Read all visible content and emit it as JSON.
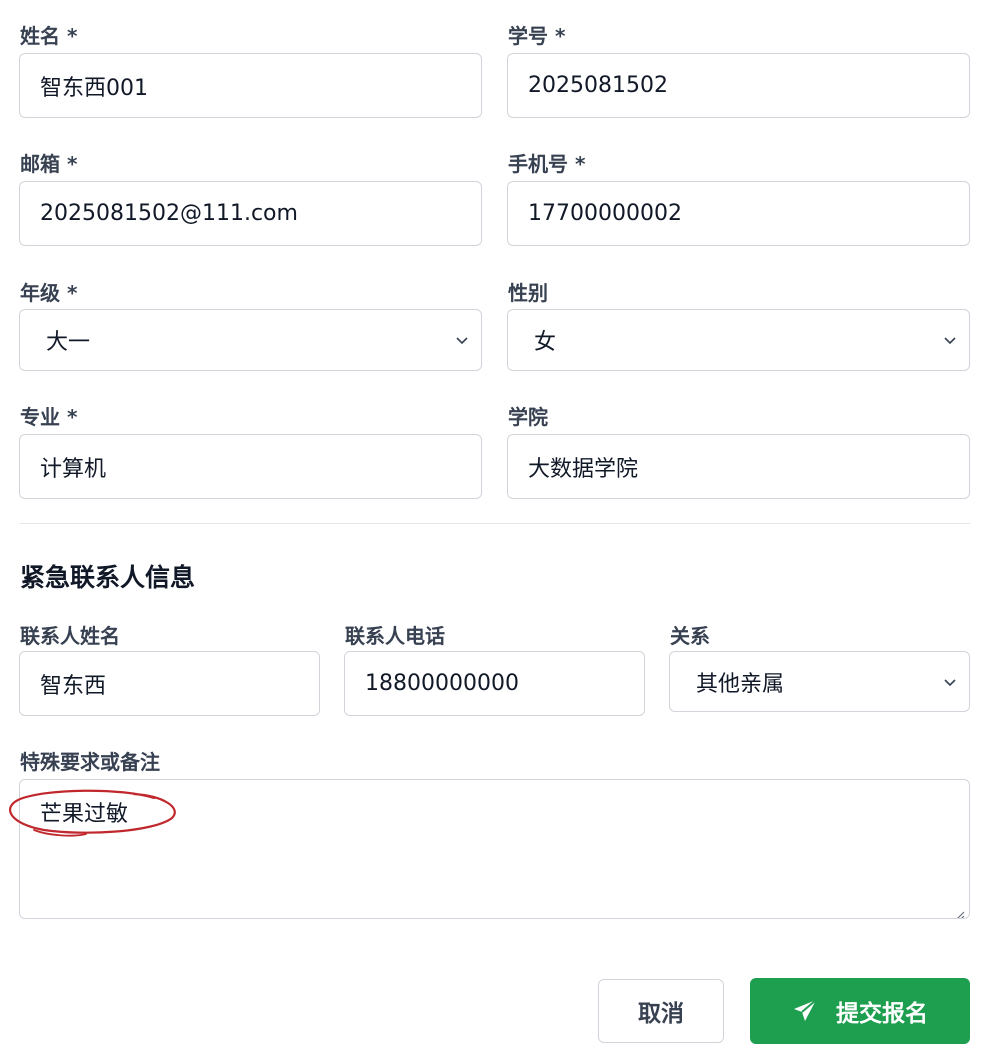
{
  "form": {
    "name": {
      "label": "姓名 *",
      "value": "智东西001"
    },
    "student_id": {
      "label": "学号 *",
      "value": "2025081502"
    },
    "email": {
      "label": "邮箱 *",
      "value": "2025081502@111.com"
    },
    "phone": {
      "label": "手机号 *",
      "value": "17700000002"
    },
    "grade": {
      "label": "年级 *",
      "value": "大一"
    },
    "gender": {
      "label": "性别",
      "value": "女"
    },
    "major": {
      "label": "专业 *",
      "value": "计算机"
    },
    "college": {
      "label": "学院",
      "value": "大数据学院"
    }
  },
  "emergency": {
    "title": "紧急联系人信息",
    "contact_name": {
      "label": "联系人姓名",
      "value": "智东西"
    },
    "contact_phone": {
      "label": "联系人电话",
      "value": "18800000000"
    },
    "relation": {
      "label": "关系",
      "value": "其他亲属"
    }
  },
  "notes": {
    "label": "特殊要求或备注",
    "value": "芒果过敏"
  },
  "buttons": {
    "cancel": "取消",
    "submit": "提交报名"
  },
  "colors": {
    "primary": "#1e9e4f",
    "annotation": "#c0282d",
    "border": "#d1d5db"
  },
  "icons": {
    "submit": "paper-plane-icon",
    "select": "chevron-down-icon",
    "resize": "resize-handle-icon"
  }
}
